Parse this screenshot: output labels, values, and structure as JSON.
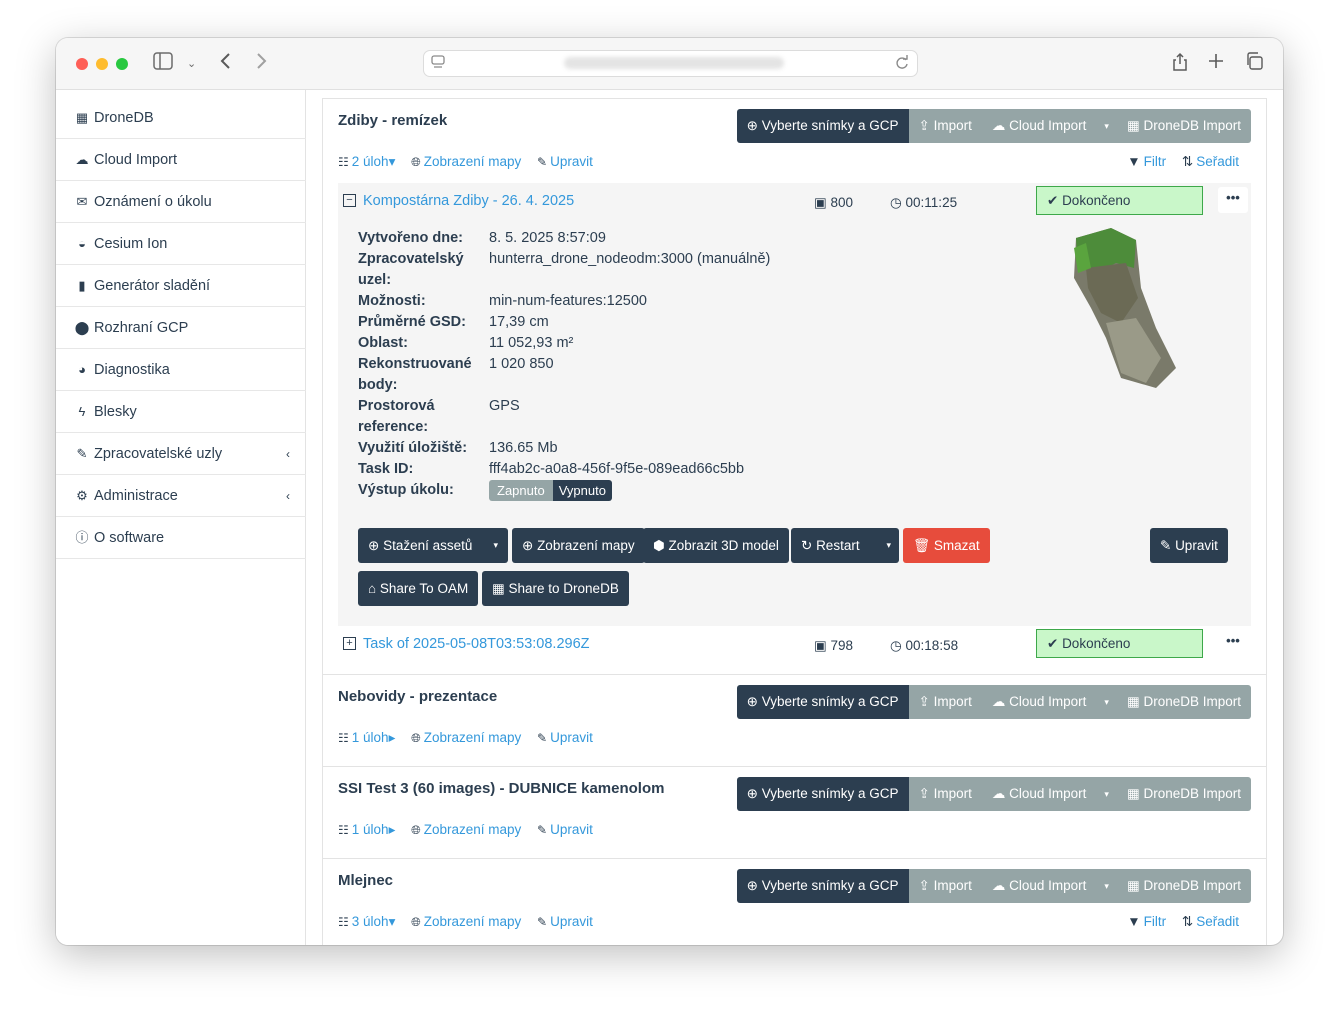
{
  "browser": {
    "url_placeholder": ""
  },
  "sidebar": {
    "items": [
      {
        "icon": "table-icon",
        "glyph": "▦",
        "label": "DroneDB"
      },
      {
        "icon": "cloud-upload-icon",
        "glyph": "☁",
        "label": "Cloud Import"
      },
      {
        "icon": "envelope-icon",
        "glyph": "✉",
        "label": "Oznámení o úkolu"
      },
      {
        "icon": "cesium-icon",
        "glyph": "◒",
        "label": "Cesium Ion"
      },
      {
        "icon": "grid-icon",
        "glyph": "▮",
        "label": "Generátor sladění"
      },
      {
        "icon": "map-marker-icon",
        "glyph": "⬤",
        "label": "Rozhraní GCP"
      },
      {
        "icon": "pie-chart-icon",
        "glyph": "◕",
        "label": "Diagnostika"
      },
      {
        "icon": "bolt-icon",
        "glyph": "ϟ",
        "label": "Blesky"
      },
      {
        "icon": "wrench-icon",
        "glyph": "✎",
        "label": "Zpracovatelské uzly",
        "chevron": "‹"
      },
      {
        "icon": "cogs-icon",
        "glyph": "⚙",
        "label": "Administrace",
        "chevron": "‹"
      },
      {
        "icon": "info-icon",
        "glyph": "ⓘ",
        "label": "O software"
      }
    ]
  },
  "project_buttons": {
    "select": "Vyberte snímky a GCP",
    "import": "Import",
    "cloud_import": "Cloud Import",
    "dronedb_import": "DroneDB Import",
    "caret": "▾",
    "tasks_caret_open": "▾",
    "tasks_caret_closed": "▸",
    "map_view": "Zobrazení mapy",
    "edit": "Upravit",
    "filter": "Filtr",
    "sort": "Seřadit"
  },
  "projects": [
    {
      "title": "Zdiby - remízek",
      "tasks_count": "2 úloh"
    },
    {
      "title": "Nebovidy - prezentace",
      "tasks_count": "1 úloh"
    },
    {
      "title": "SSI Test 3 (60 images) - DUBNICE kamenolom",
      "tasks_count": "1 úloh"
    },
    {
      "title": "Mlejnec",
      "tasks_count": "3 úloh"
    }
  ],
  "tasks": [
    {
      "name": "Kompostárna Zdiby - 26. 4. 2025",
      "images": "800",
      "duration": "00:11:25",
      "status": "Dokončeno",
      "toggle": "−"
    },
    {
      "name": "Task of 2025-05-08T03:53:08.296Z",
      "images": "798",
      "duration": "00:18:58",
      "status": "Dokončeno",
      "toggle": "+"
    }
  ],
  "task_details": {
    "created_label": "Vytvořeno dne:",
    "created_value": "8. 5. 2025 8:57:09",
    "node_label": "Zpracovatelský uzel:",
    "node_value": "hunterra_drone_nodeodm:3000 (manuálně)",
    "options_label": "Možnosti:",
    "options_value": "min-num-features:12500",
    "gsd_label": "Průměrné GSD:",
    "gsd_value": "17,39 cm",
    "area_label": "Oblast:",
    "area_value": "11 052,93 m²",
    "points_label": "Rekonstruované body:",
    "points_value": "1 020 850",
    "srs_label": "Prostorová reference:",
    "srs_value": "GPS",
    "storage_label": "Využití úložiště:",
    "storage_value": "136.65 Mb",
    "taskid_label": "Task ID:",
    "taskid_value": "fff4ab2c-a0a8-456f-9f5e-089ead66c5bb",
    "output_label": "Výstup úkolu:",
    "output_on": "Zapnuto",
    "output_off": "Vypnuto"
  },
  "task_actions": {
    "download": "Stažení assetů",
    "map": "Zobrazení mapy",
    "model": "Zobrazit 3D model",
    "restart": "Restart",
    "delete": "Smazat",
    "edit": "Upravit",
    "oam": "Share To OAM",
    "ddb": "Share to DroneDB",
    "caret": "▾",
    "more": "•••"
  }
}
